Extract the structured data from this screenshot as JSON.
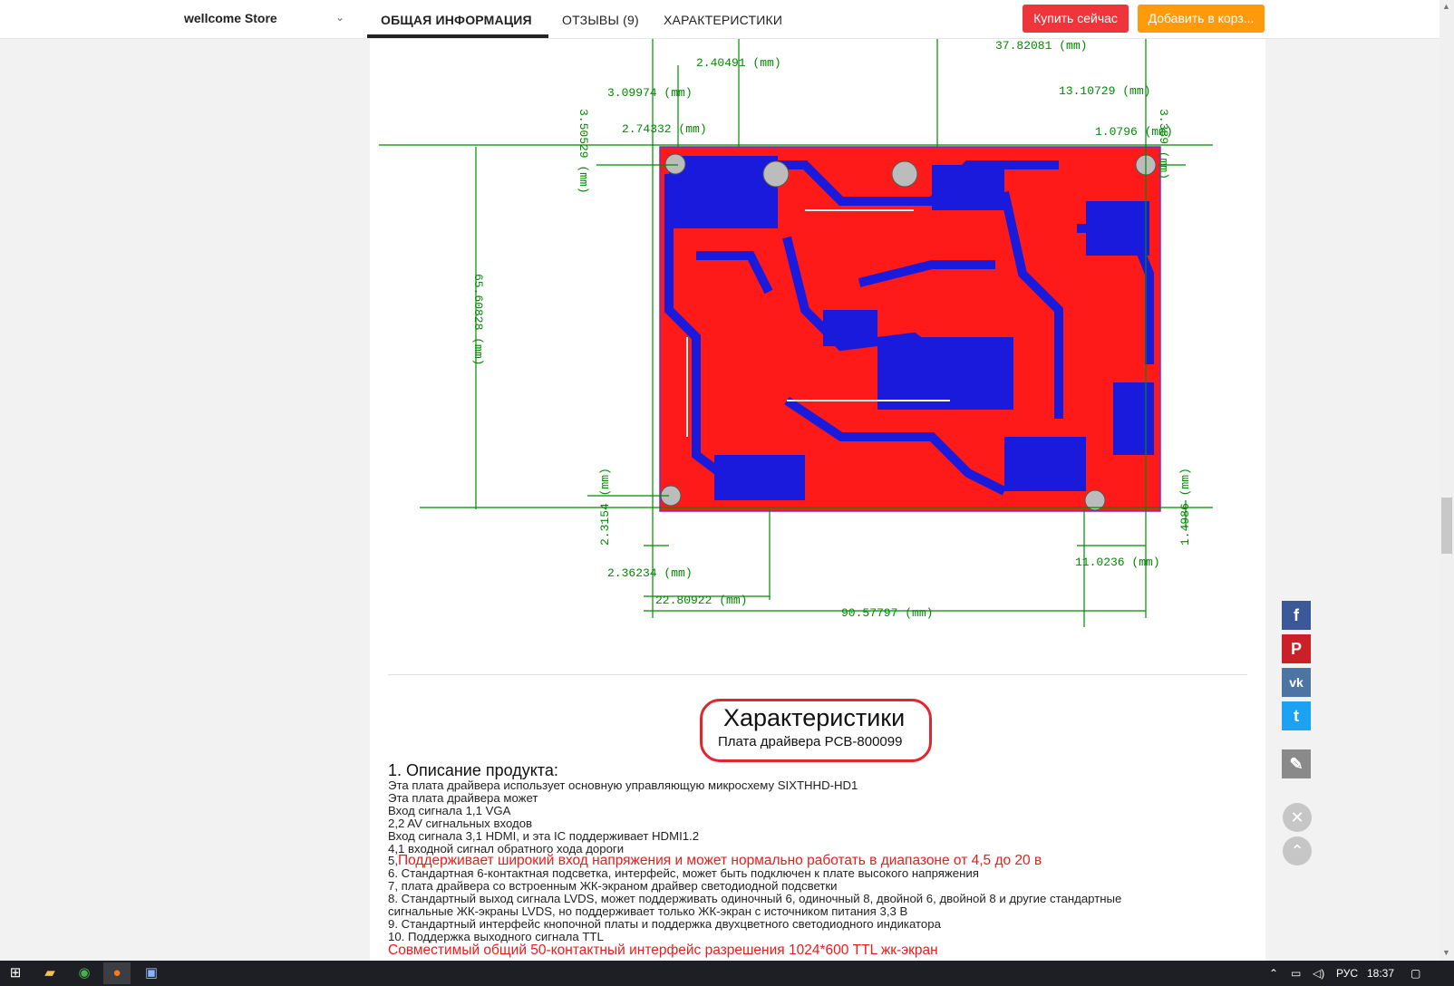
{
  "header": {
    "store_name": "wellcome Store",
    "tabs": [
      {
        "label": "ОБЩАЯ ИНФОРМАЦИЯ",
        "active": true
      },
      {
        "label": "ОТЗЫВЫ (9)",
        "active": false
      },
      {
        "label": "ХАРАКТЕРИСТИКИ",
        "active": false
      }
    ],
    "buy_now": "Купить сейчас",
    "add_to_cart": "Добавить в корз..."
  },
  "diagram": {
    "dims": {
      "d1": "37.82081 (mm)",
      "d2": "2.40491 (mm)",
      "d3": "3.09974 (mm)",
      "d4": "13.10729 (mm)",
      "d5": "2.74332 (mm)",
      "d6": "1.0796 (mm)",
      "d7": "3.50529 (mm)",
      "d8": "3.389 (mm)",
      "d9": "65.60828 (mm)",
      "d10": "2.3154 (mm)",
      "d11": "1.4986 (mm)",
      "d12": "2.36234 (mm)",
      "d13": "11.0236 (mm)",
      "d14": "22.80922 (mm)",
      "d15": "90.57797 (mm)"
    }
  },
  "specs": {
    "title": "Характеристики",
    "subtitle": "Плата драйвера PCB-800099",
    "heading": "1. Описание продукта:",
    "line1": "Эта плата драйвера использует основную управляющую микросхему SIXTHHD-HD1",
    "line2": "Эта плата драйвера может",
    "line3": "Вход сигнала 1,1 VGA",
    "line4": "2,2 AV сигнальных входов",
    "line5": "Вход сигнала 3,1 HDMI, и эта IC поддерживает HDMI1.2",
    "line6": "4,1 входной сигнал обратного хода дороги",
    "line7_prefix": "5,",
    "line7_red": "Поддерживает широкий вход напряжения и может нормально работать в диапазоне от 4,5 до 20 в",
    "line8": "6. Стандартная 6-контактная подсветка, интерфейс, может быть подключен к плате высокого напряжения",
    "line9": "7, плата драйвера со встроенным ЖК-экраном драйвер светодиодной подсветки",
    "line10": "8. Стандартный выход сигнала LVDS, может поддерживать одиночный 6, одиночный 8, двойной 6, двойной 8 и другие стандартные",
    "line11": "сигнальные ЖК-экраны LVDS, но поддерживает только ЖК-экран с источником питания 3,3 В",
    "line12": "9. Стандартный интерфейс кнопочной платы и поддержка двухцветного светодиодного индикатора",
    "line13": "10. Поддержка выходного сигнала TTL",
    "line14_red": "Совместимый общий 50-контактный интерфейс разрешения 1024*600 TTL жк-экран"
  },
  "share": {
    "facebook": "f",
    "pinterest": "P",
    "vk": "vk",
    "twitter": "t",
    "edit": "✎",
    "close": "✕",
    "up": "⌃"
  },
  "taskbar": {
    "lang": "РУС",
    "time": "18:37",
    "icons": [
      "windows-icon",
      "folder-icon",
      "chrome-icon",
      "firefox-icon",
      "app-icon"
    ]
  },
  "colors": {
    "buy": "#f0343c",
    "cart": "#fe9a0c",
    "pcb_red": "#ff1a1a",
    "pcb_blue": "#1a1adc",
    "dim_green": "#008a00",
    "highlight": "#e0262e"
  }
}
